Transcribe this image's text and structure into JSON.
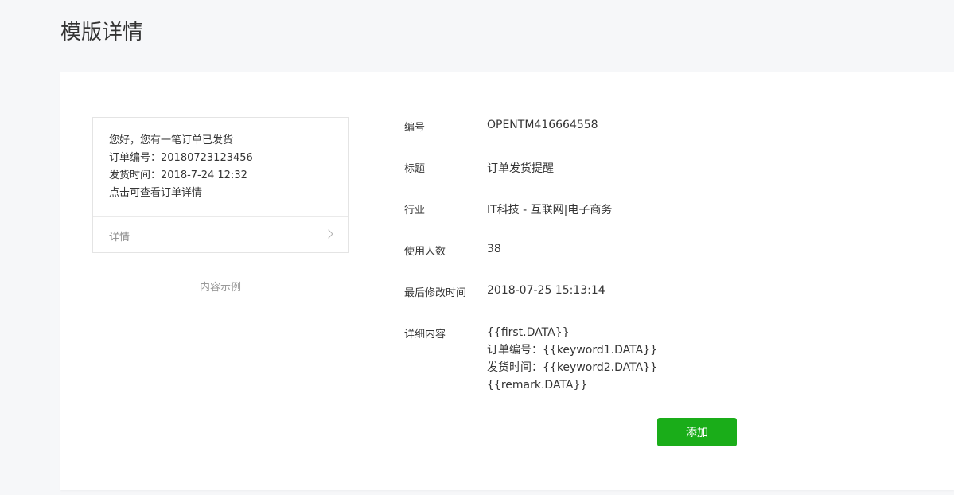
{
  "page": {
    "title": "模版详情"
  },
  "preview": {
    "lines": [
      "您好，您有一笔订单已发货",
      "订单编号：20180723123456",
      "发货时间：2018-7-24 12:32",
      "点击可查看订单详情"
    ],
    "detail_label": "详情",
    "caption": "内容示例"
  },
  "info": {
    "id_label": "编号",
    "id_value": "OPENTM416664558",
    "title_label": "标题",
    "title_value": "订单发货提醒",
    "industry_label": "行业",
    "industry_value": "IT科技 - 互联网|电子商务",
    "users_label": "使用人数",
    "users_value": "38",
    "modified_label": "最后修改时间",
    "modified_value": "2018-07-25 15:13:14",
    "content_label": "详细内容",
    "content_lines": [
      "{{first.DATA}}",
      "订单编号：{{keyword1.DATA}}",
      "发货时间：{{keyword2.DATA}}",
      "{{remark.DATA}}"
    ]
  },
  "actions": {
    "add_label": "添加"
  }
}
